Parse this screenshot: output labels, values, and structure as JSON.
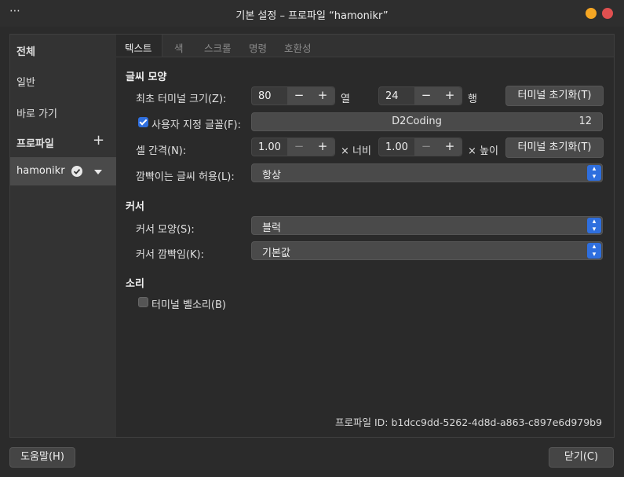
{
  "window": {
    "title": "기본 설정 – 프로파일 “hamonikr”",
    "menu_icon": "⋯"
  },
  "sidebar": {
    "items": [
      "전체",
      "일반",
      "바로 가기"
    ],
    "profiles_header": "프로파일",
    "add_icon": "+",
    "profile_name": "hamonikr"
  },
  "tabs": [
    "텍스트",
    "색",
    "스크롤",
    "명령",
    "호환성"
  ],
  "text_section": {
    "header": "글씨 모양",
    "initial_size_label": "최초 터미널 크기(Z):",
    "columns_value": "80",
    "columns_unit": "열",
    "rows_value": "24",
    "rows_unit": "행",
    "reset_button": "터미널 초기화(T)",
    "custom_font_label": "사용자 지정 글꼴(F):",
    "custom_font_checked": true,
    "font_name": "D2Coding",
    "font_size": "12",
    "cell_spacing_label": "셀 간격(N):",
    "width_value": "1.00",
    "width_unit": "× 너비",
    "height_value": "1.00",
    "height_unit": "× 높이",
    "reset_button2": "터미널 초기화(T)",
    "blink_label": "깜빡이는 글씨 허용(L):",
    "blink_value": "항상"
  },
  "cursor_section": {
    "header": "커서",
    "shape_label": "커서 모양(S):",
    "shape_value": "블럭",
    "blink_label": "커서 깜빡임(K):",
    "blink_value": "기본값"
  },
  "sound_section": {
    "header": "소리",
    "bell_label": "터미널 벨소리(B)",
    "bell_checked": false
  },
  "profile_id": "프로파일 ID:  b1dcc9dd-5262-4d8d-a863-c897e6d979b9",
  "footer": {
    "help": "도움말(H)",
    "close": "닫기(C)"
  },
  "colors": {
    "accent": "#2f6fde",
    "minimize": "#f5a623",
    "close": "#e05050"
  }
}
